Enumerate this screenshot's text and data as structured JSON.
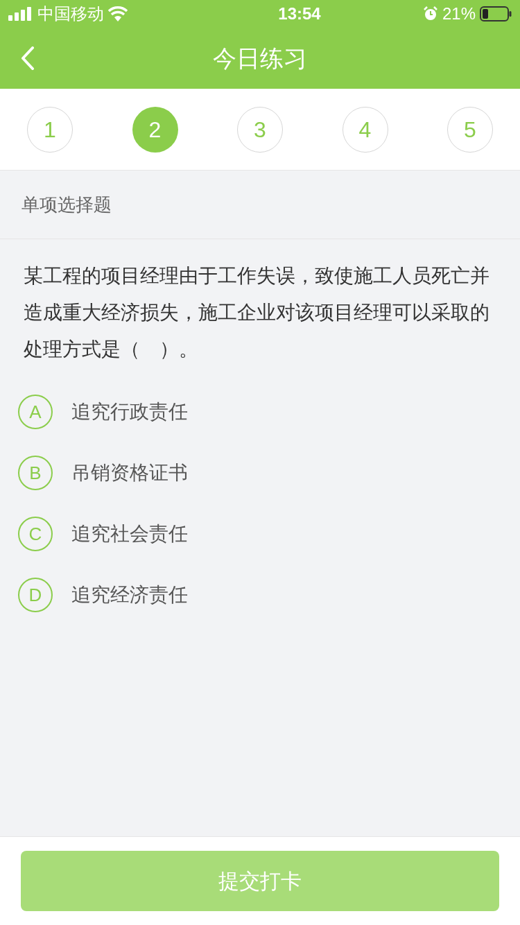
{
  "status_bar": {
    "carrier": "中国移动",
    "time": "13:54",
    "battery": "21%"
  },
  "nav": {
    "title": "今日练习"
  },
  "question_tabs": [
    {
      "label": "1",
      "selected": false
    },
    {
      "label": "2",
      "selected": true
    },
    {
      "label": "3",
      "selected": false
    },
    {
      "label": "4",
      "selected": false
    },
    {
      "label": "5",
      "selected": false
    }
  ],
  "question": {
    "type": "单项选择题",
    "text": "某工程的项目经理由于工作失误，致使施工人员死亡并造成重大经济损失，施工企业对该项目经理可以采取的处理方式是（　）。",
    "options": [
      {
        "letter": "A",
        "text": "追究行政责任",
        "selected": false
      },
      {
        "letter": "B",
        "text": "吊销资格证书",
        "selected": false
      },
      {
        "letter": "C",
        "text": "追究社会责任",
        "selected": false
      },
      {
        "letter": "D",
        "text": "追究经济责任",
        "selected": false
      }
    ]
  },
  "submit_button": {
    "label": "提交打卡",
    "disabled": true
  }
}
